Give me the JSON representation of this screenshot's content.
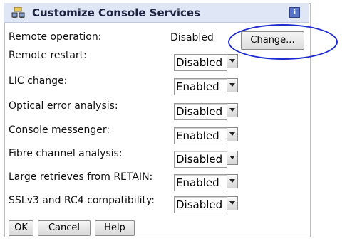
{
  "title": "Customize Console Services",
  "icons": {
    "title_icon": "console-services-icon",
    "info": "i"
  },
  "remote_operation": {
    "label": "Remote operation:",
    "value": "Disabled",
    "change_label": "Change..."
  },
  "settings": [
    {
      "label": "Remote restart:",
      "value": "Disabled"
    },
    {
      "label": "LIC change:",
      "value": "Enabled"
    },
    {
      "label": "Optical error analysis:",
      "value": "Disabled"
    },
    {
      "label": "Console messenger:",
      "value": "Enabled"
    },
    {
      "label": "Fibre channel analysis:",
      "value": "Disabled"
    },
    {
      "label": "Large retrieves from RETAIN:",
      "value": "Enabled"
    },
    {
      "label": "SSLv3 and RC4 compatibility:",
      "value": "Disabled"
    }
  ],
  "buttons": {
    "ok": "OK",
    "cancel": "Cancel",
    "help": "Help"
  },
  "colors": {
    "titlebar": "#dfe6f5",
    "highlight": "#1d2bd0"
  }
}
